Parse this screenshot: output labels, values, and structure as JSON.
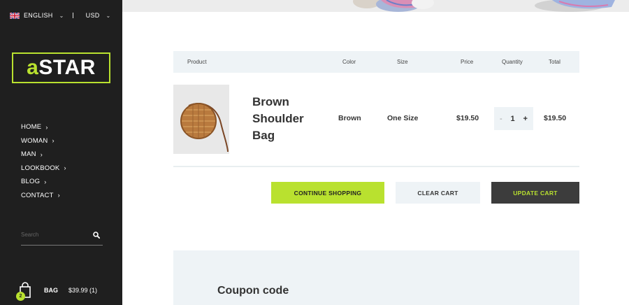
{
  "topbar": {
    "language": "ENGLISH",
    "currency": "USD"
  },
  "logo": {
    "accent": "a",
    "rest": "STAR"
  },
  "nav": [
    {
      "label": "HOME"
    },
    {
      "label": "WOMAN"
    },
    {
      "label": "MAN"
    },
    {
      "label": "LOOKBOOK"
    },
    {
      "label": "BLOG"
    },
    {
      "label": "CONTACT"
    }
  ],
  "search": {
    "placeholder": "Search"
  },
  "bag": {
    "count": "2",
    "label": "BAG",
    "summary": "$39.99 (1)"
  },
  "cart": {
    "headers": {
      "product": "Product",
      "color": "Color",
      "size": "Size",
      "price": "Price",
      "quantity": "Quantity",
      "total": "Total"
    },
    "items": [
      {
        "name": "Brown Shoulder Bag",
        "color": "Brown",
        "size": "One Size",
        "price": "$19.50",
        "quantity": "1",
        "total": "$19.50"
      }
    ]
  },
  "actions": {
    "continue": "CONTINUE SHOPPING",
    "clear": "CLEAR CART",
    "update": "UPDATE CART"
  },
  "coupon": {
    "title": "Coupon code"
  },
  "colors": {
    "accent": "#b9e12f",
    "sidebar": "#1f1f1f",
    "panel": "#eef3f6",
    "dark_button": "#3c3c3c"
  }
}
